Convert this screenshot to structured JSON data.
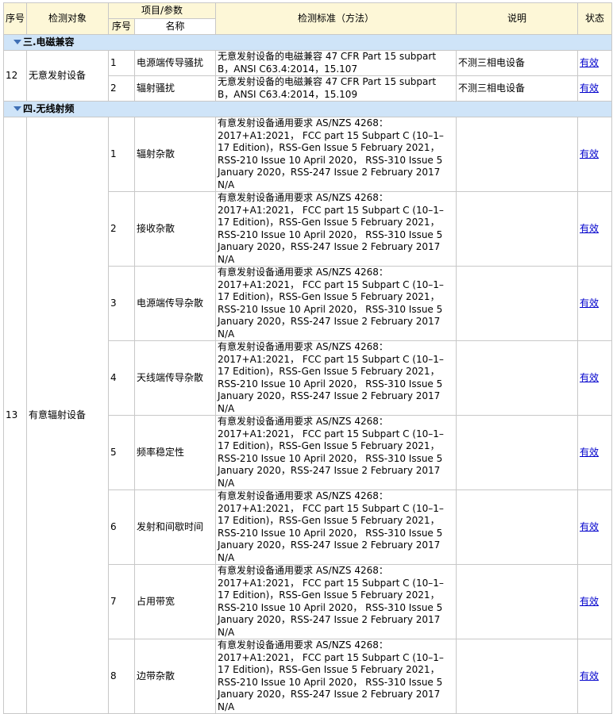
{
  "header": {
    "seq": "序号",
    "object": "检测对象",
    "param_group": "项目/参数",
    "param_seq": "序号",
    "param_name": "名称",
    "standard": "检测标准（方法）",
    "note": "说明",
    "status": "状态"
  },
  "sections": [
    {
      "title": "三.电磁兼容",
      "groups": [
        {
          "seq": "12",
          "object": "无意发射设备",
          "items": [
            {
              "no": "1",
              "name": "电源端传导骚扰",
              "standard": "无意发射设备的电磁兼容 47 CFR Part 15 subpart B，ANSI C63.4:2014，15.107",
              "note": "不测三相电设备",
              "status": "有效"
            },
            {
              "no": "2",
              "name": "辐射骚扰",
              "standard": "无意发射设备的电磁兼容 47 CFR Part 15 subpart B，ANSI C63.4:2014，15.109",
              "note": "不测三相电设备",
              "status": "有效"
            }
          ]
        }
      ]
    },
    {
      "title": "四.无线射频",
      "groups": [
        {
          "seq": "13",
          "object": "有意辐射设备",
          "items": [
            {
              "no": "1",
              "name": "辐射杂散",
              "standard": "有意发射设备通用要求 AS/NZS 4268：2017+A1:2021， FCC part 15 Subpart C (10–1–17 Edition)，RSS-Gen Issue 5 February 2021， RSS-210 Issue 10 April 2020， RSS-310 Issue 5 January 2020，RSS-247 Issue 2 February 2017 N/A",
              "note": "",
              "status": "有效"
            },
            {
              "no": "2",
              "name": "接收杂散",
              "standard": "有意发射设备通用要求 AS/NZS 4268：2017+A1:2021， FCC part 15 Subpart C (10–1–17 Edition)，RSS-Gen Issue 5 February 2021， RSS-210 Issue 10 April 2020， RSS-310 Issue 5 January 2020，RSS-247 Issue 2 February 2017 N/A",
              "note": "",
              "status": "有效"
            },
            {
              "no": "3",
              "name": "电源端传导杂散",
              "standard": "有意发射设备通用要求 AS/NZS 4268：2017+A1:2021， FCC part 15 Subpart C (10–1–17 Edition)，RSS-Gen Issue 5 February 2021， RSS-210 Issue 10 April 2020， RSS-310 Issue 5 January 2020，RSS-247 Issue 2 February 2017 N/A",
              "note": "",
              "status": "有效"
            },
            {
              "no": "4",
              "name": "天线端传导杂散",
              "standard": "有意发射设备通用要求 AS/NZS 4268：2017+A1:2021， FCC part 15 Subpart C (10–1–17 Edition)，RSS-Gen Issue 5 February 2021， RSS-210 Issue 10 April 2020， RSS-310 Issue 5 January 2020，RSS-247 Issue 2 February 2017 N/A",
              "note": "",
              "status": "有效"
            },
            {
              "no": "5",
              "name": "频率稳定性",
              "standard": "有意发射设备通用要求 AS/NZS 4268：2017+A1:2021， FCC part 15 Subpart C (10–1–17 Edition)，RSS-Gen Issue 5 February 2021， RSS-210 Issue 10 April 2020， RSS-310 Issue 5 January 2020，RSS-247 Issue 2 February 2017 N/A",
              "note": "",
              "status": "有效"
            },
            {
              "no": "6",
              "name": "发射和间歇时间",
              "standard": "有意发射设备通用要求 AS/NZS 4268：2017+A1:2021， FCC part 15 Subpart C (10–1–17 Edition)，RSS-Gen Issue 5 February 2021， RSS-210 Issue 10 April 2020， RSS-310 Issue 5 January 2020，RSS-247 Issue 2 February 2017 N/A",
              "note": "",
              "status": "有效"
            },
            {
              "no": "7",
              "name": "占用带宽",
              "standard": "有意发射设备通用要求 AS/NZS 4268：2017+A1:2021， FCC part 15 Subpart C (10–1–17 Edition)，RSS-Gen Issue 5 February 2021， RSS-210 Issue 10 April 2020， RSS-310 Issue 5 January 2020，RSS-247 Issue 2 February 2017 N/A",
              "note": "",
              "status": "有效"
            },
            {
              "no": "8",
              "name": "边带杂散",
              "standard": "有意发射设备通用要求 AS/NZS 4268：2017+A1:2021， FCC part 15 Subpart C (10–1–17 Edition)，RSS-Gen Issue 5 February 2021， RSS-210 Issue 10 April 2020， RSS-310 Issue 5 January 2020，RSS-247 Issue 2 February 2017 N/A",
              "note": "",
              "status": "有效"
            }
          ]
        }
      ]
    }
  ]
}
